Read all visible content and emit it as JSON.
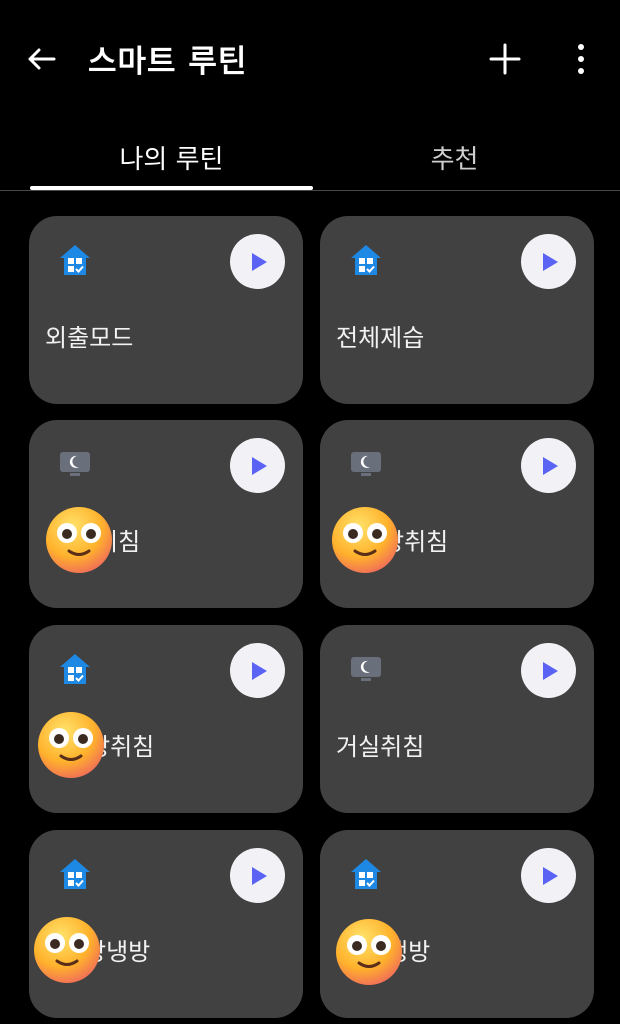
{
  "header": {
    "title": "스마트 루틴"
  },
  "tabs": [
    {
      "label": "나의 루틴",
      "selected": true
    },
    {
      "label": "추천",
      "selected": false
    }
  ],
  "routines": [
    {
      "name": "외출모드",
      "icon": "home-icon"
    },
    {
      "name": "전체제습",
      "icon": "home-icon"
    },
    {
      "name": "취침",
      "icon": "monitor-moon-icon"
    },
    {
      "name": "방취침",
      "icon": "monitor-moon-icon"
    },
    {
      "name": "방취침",
      "icon": "home-icon"
    },
    {
      "name": "거실취침",
      "icon": "monitor-moon-icon"
    },
    {
      "name": "방냉방",
      "icon": "home-icon"
    },
    {
      "name": "냉방",
      "icon": "home-icon"
    }
  ],
  "colors": {
    "accent_play": "#5b63f5",
    "home_icon_blue": "#1e88e5",
    "card_bg": "#414141"
  }
}
